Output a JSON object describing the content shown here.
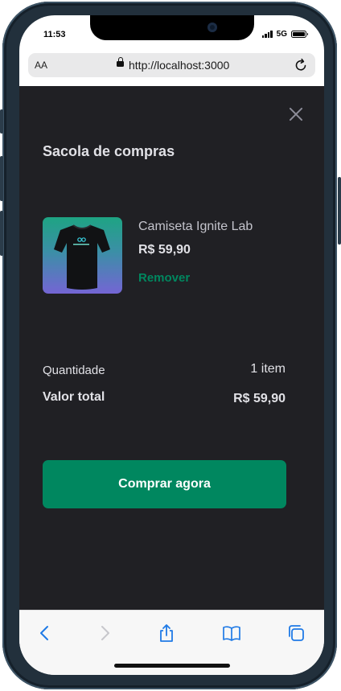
{
  "status_bar": {
    "time": "11:53",
    "network": "5G"
  },
  "browser": {
    "text_size_label": "AA",
    "url": "http://localhost:3000"
  },
  "cart": {
    "title": "Sacola de compras",
    "items": [
      {
        "name": "Camiseta Ignite Lab",
        "price": "R$ 59,90",
        "remove_label": "Remover"
      }
    ],
    "quantity_label": "Quantidade",
    "quantity_value": "1 item",
    "total_label": "Valor total",
    "total_value": "R$ 59,90",
    "buy_label": "Comprar agora"
  },
  "icons": {
    "close": "close-icon",
    "back": "chevron-left-icon",
    "forward": "chevron-right-icon",
    "share": "share-icon",
    "bookmarks": "book-icon",
    "tabs": "tabs-icon",
    "reload": "reload-icon",
    "lock": "lock-icon"
  },
  "colors": {
    "background": "#202024",
    "primary": "#00875f",
    "text": "#e1e1e6",
    "muted": "#8d8d99",
    "ios_blue": "#1f7ae6"
  }
}
